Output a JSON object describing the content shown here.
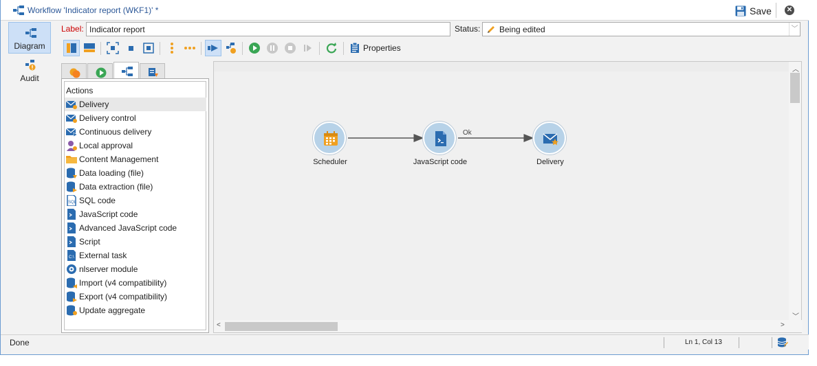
{
  "window": {
    "title": "Workflow 'Indicator report (WKF1)' *",
    "save_label": "Save"
  },
  "leftnav": {
    "items": [
      {
        "label": "Diagram",
        "icon": "diagram-icon",
        "active": true
      },
      {
        "label": "Audit",
        "icon": "audit-icon",
        "active": false
      }
    ]
  },
  "form": {
    "label_caption": "Label:",
    "label_value": "Indicator report",
    "status_caption": "Status:",
    "status_value": "Being edited"
  },
  "toolbar": {
    "properties_label": "Properties",
    "buttons": [
      "vertical-split-icon",
      "horizontal-split-icon",
      "fit-icon",
      "normal-size-icon",
      "zoom-fit-icon",
      "vertical-dots-icon",
      "horizontal-dots-icon",
      "start-arrow-icon",
      "workflow-props-icon",
      "play-icon",
      "pause-icon",
      "stop-icon",
      "step-icon",
      "refresh-icon"
    ]
  },
  "palette": {
    "tabs": [
      "targeting-icon",
      "flow-control-icon",
      "actions-icon",
      "events-icon"
    ],
    "heading": "Actions",
    "items": [
      {
        "label": "Delivery",
        "icon": "delivery-icon"
      },
      {
        "label": "Delivery control",
        "icon": "delivery-control-icon"
      },
      {
        "label": "Continuous delivery",
        "icon": "continuous-delivery-icon"
      },
      {
        "label": "Local approval",
        "icon": "local-approval-icon"
      },
      {
        "label": "Content Management",
        "icon": "folder-icon"
      },
      {
        "label": "Data loading (file)",
        "icon": "data-loading-icon"
      },
      {
        "label": "Data extraction (file)",
        "icon": "data-extraction-icon"
      },
      {
        "label": "SQL code",
        "icon": "sql-icon"
      },
      {
        "label": "JavaScript code",
        "icon": "javascript-icon"
      },
      {
        "label": "Advanced JavaScript code",
        "icon": "advanced-javascript-icon"
      },
      {
        "label": "Script",
        "icon": "script-icon"
      },
      {
        "label": "External task",
        "icon": "external-task-icon"
      },
      {
        "label": "nlserver module",
        "icon": "nlserver-icon"
      },
      {
        "label": "Import (v4 compatibility)",
        "icon": "import-icon"
      },
      {
        "label": "Export (v4 compatibility)",
        "icon": "export-icon"
      },
      {
        "label": "Update aggregate",
        "icon": "update-aggregate-icon"
      }
    ]
  },
  "diagram": {
    "nodes": [
      {
        "label": "Scheduler",
        "icon": "calendar-icon"
      },
      {
        "label": "JavaScript code",
        "icon": "javascript-icon"
      },
      {
        "label": "Delivery",
        "icon": "delivery-icon"
      }
    ],
    "transition_label": "Ok"
  },
  "statusbar": {
    "state": "Done",
    "position": "Ln 1, Col 13"
  },
  "colors": {
    "accent": "#2b5797",
    "node_fill": "#b7d2e8",
    "active_bg": "#cde0f7"
  }
}
